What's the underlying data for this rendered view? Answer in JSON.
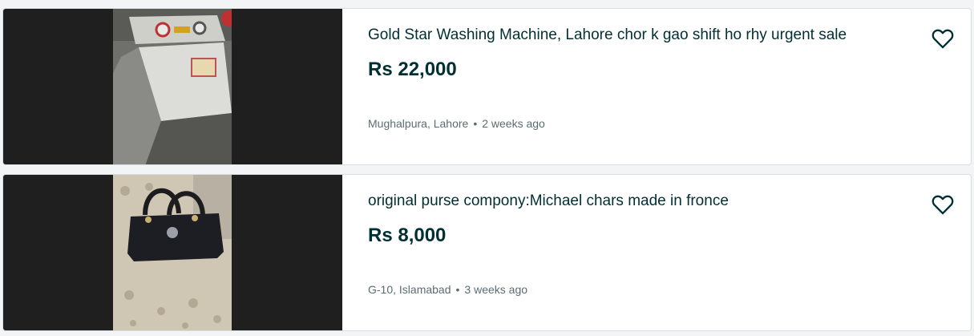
{
  "listings": [
    {
      "title": "Gold Star Washing Machine, Lahore chor k gao shift ho rhy urgent sale",
      "price": "Rs 22,000",
      "location": "Mughalpura, Lahore",
      "separator": "•",
      "posted": "2 weeks ago",
      "favorite_icon": "heart-outline-icon"
    },
    {
      "title": "original purse compony:Michael chars made in fronce",
      "price": "Rs 8,000",
      "location": "G-10, Islamabad",
      "separator": "•",
      "posted": "3 weeks ago",
      "favorite_icon": "heart-outline-icon"
    }
  ],
  "colors": {
    "title": "#002f34",
    "meta": "#5b6d70",
    "card_border": "#d8dfe0",
    "thumb_background": "#1f1f1f",
    "page_background": "#f2f4f5"
  }
}
